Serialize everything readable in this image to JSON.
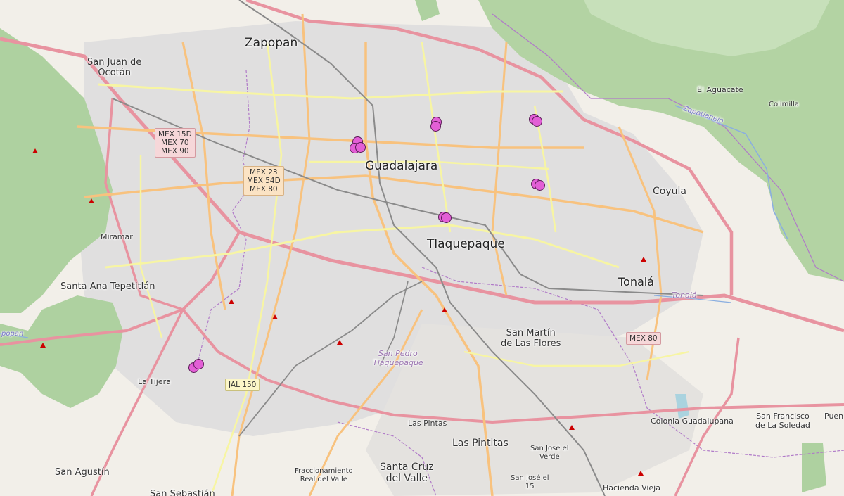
{
  "map": {
    "places": {
      "zapopan": "Zapopan",
      "guadalajara": "Guadalajara",
      "tlaquepaque": "Tlaquepaque",
      "tonala": "Tonalá",
      "coyula": "Coyula",
      "san_juan_ocotan_1": "San Juan de",
      "san_juan_ocotan_2": "Ocotán",
      "miramar": "Miramar",
      "santa_ana": "Santa Ana Tepetitlán",
      "la_tijera": "La Tijera",
      "san_martin_1": "San Martín",
      "san_martin_2": "de Las Flores",
      "las_pintas": "Las Pintas",
      "las_pintitas": "Las Pintitas",
      "santa_cruz_1": "Santa Cruz",
      "santa_cruz_2": "del Valle",
      "fracc_1": "Fraccionamiento",
      "fracc_2": "Real del Valle",
      "san_jose_verde_1": "San José el",
      "san_jose_verde_2": "Verde",
      "san_jose_15_1": "San José el",
      "san_jose_15_2": "15",
      "hacienda_vieja": "Hacienda Vieja",
      "colonia_guadalupana": "Colonia Guadalupana",
      "san_francisco_1": "San Francisco",
      "san_francisco_2": "de La Soledad",
      "puente": "Puen",
      "el_aguacate": "El Aguacate",
      "colimilla": "Colimilla",
      "san_agustin": "San Agustín",
      "san_sebastian": "San Sebastián",
      "san_pedro_1": "San Pedro",
      "san_pedro_2": "Tlaquepaque",
      "zapotlanejo": "Zapotlanejo",
      "tonala_muni": "Tonalá",
      "popan": "popan"
    },
    "shields": {
      "s1": [
        "MEX 15D",
        "MEX 70",
        "MEX 90"
      ],
      "s2": [
        "MEX 23",
        "MEX 54D",
        "MEX 80"
      ],
      "s3": "MEX 80",
      "s4": "JAL 150"
    },
    "marker_color": "#e35fd6",
    "markers": [
      {
        "id": "m1"
      },
      {
        "id": "m2"
      },
      {
        "id": "m3"
      },
      {
        "id": "m4"
      },
      {
        "id": "m5"
      },
      {
        "id": "m6"
      }
    ]
  }
}
